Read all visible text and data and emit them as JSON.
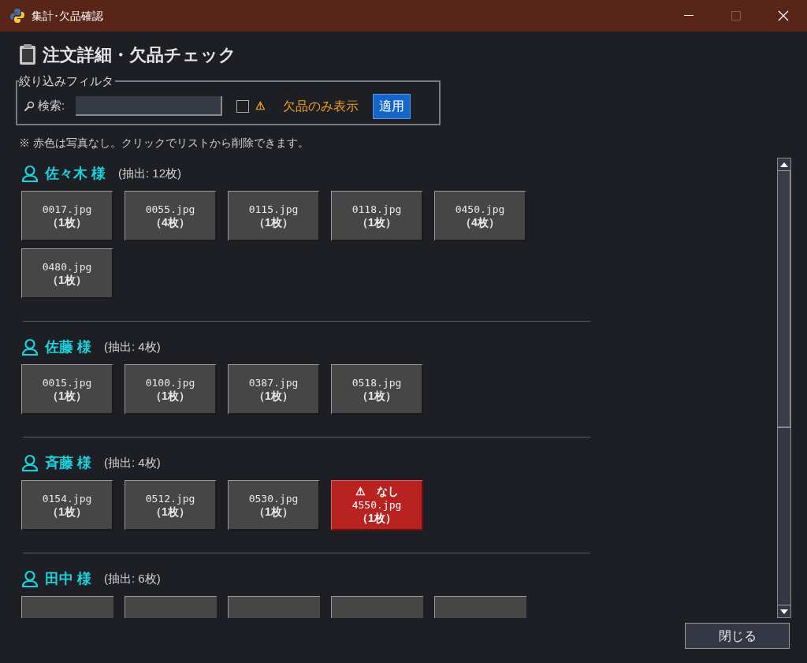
{
  "window": {
    "title": "集計･欠品確認"
  },
  "heading": "注文詳細・欠品チェック",
  "filter": {
    "legend": "絞り込みフィルタ",
    "search_label": "検索:",
    "missing_only": {
      "checked": false,
      "icon": "⚠",
      "label": "欠品のみ表示"
    },
    "apply": "適用"
  },
  "note": "※ 赤色は写真なし。クリックでリストから削除できます。",
  "customers": [
    {
      "name": "佐々木 様",
      "extracted": "(抽出: 12枚)",
      "tiles": [
        {
          "kind": "photo",
          "file": "0017.jpg",
          "count": "（1枚）",
          "missing": false
        },
        {
          "kind": "photo",
          "file": "0055.jpg",
          "count": "（4枚）",
          "missing": false
        },
        {
          "kind": "photo",
          "file": "0115.jpg",
          "count": "（1枚）",
          "missing": false
        },
        {
          "kind": "photo",
          "file": "0118.jpg",
          "count": "（1枚）",
          "missing": false
        },
        {
          "kind": "photo",
          "file": "0450.jpg",
          "count": "（4枚）",
          "missing": false
        },
        {
          "kind": "photo",
          "file": "0480.jpg",
          "count": "（1枚）",
          "missing": false
        }
      ]
    },
    {
      "name": "佐藤 様",
      "extracted": "(抽出: 4枚)",
      "tiles": [
        {
          "kind": "photo",
          "file": "0015.jpg",
          "count": "（1枚）",
          "missing": false
        },
        {
          "kind": "photo",
          "file": "0100.jpg",
          "count": "（1枚）",
          "missing": false
        },
        {
          "kind": "photo",
          "file": "0387.jpg",
          "count": "（1枚）",
          "missing": false
        },
        {
          "kind": "photo",
          "file": "0518.jpg",
          "count": "（1枚）",
          "missing": false
        }
      ]
    },
    {
      "name": "斉藤 様",
      "extracted": "(抽出: 4枚)",
      "tiles": [
        {
          "kind": "photo",
          "file": "0154.jpg",
          "count": "（1枚）",
          "missing": false
        },
        {
          "kind": "photo",
          "file": "0512.jpg",
          "count": "（1枚）",
          "missing": false
        },
        {
          "kind": "photo",
          "file": "0530.jpg",
          "count": "（1枚）",
          "missing": false
        },
        {
          "kind": "photo",
          "file": "4550.jpg",
          "count": "（1枚）",
          "missing": true,
          "badge": "⚠　なし"
        }
      ]
    },
    {
      "name": "田中 様",
      "extracted": "(抽出: 6枚)",
      "tiles": [
        {
          "kind": "clipped"
        },
        {
          "kind": "clipped"
        },
        {
          "kind": "clipped"
        },
        {
          "kind": "clipped"
        },
        {
          "kind": "clipped"
        }
      ]
    }
  ],
  "close_button": "閉じる"
}
